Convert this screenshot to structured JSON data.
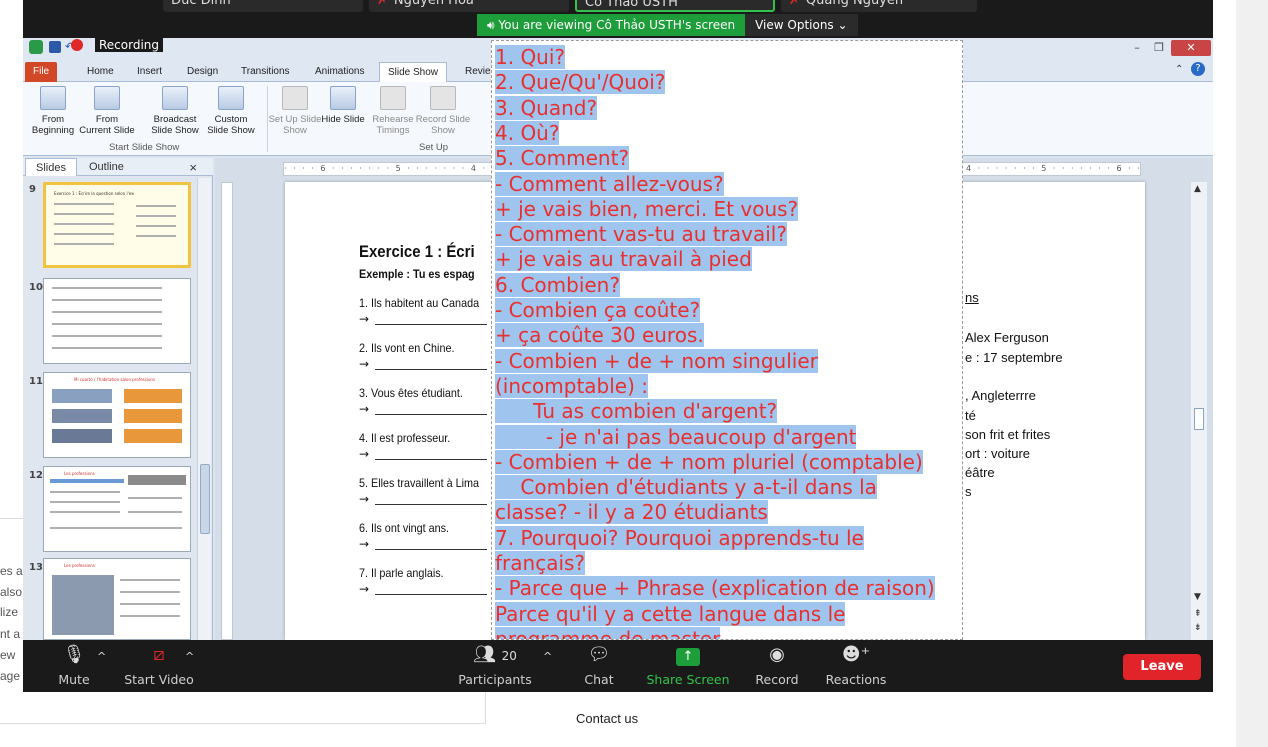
{
  "background": {
    "fragments": [
      "es a",
      "also",
      "lize",
      "nt a",
      "ew",
      "age"
    ],
    "contact_link": "Contact us"
  },
  "zoom": {
    "participants_tiles": [
      "Đức Đình",
      "Nguyễn Hoà",
      "Cô Thảo USTH",
      "Quang Nguyễn"
    ],
    "viewing_text": "You are viewing Cô Thảo USTH's screen",
    "view_options": "View Options",
    "recording_label": "Recording",
    "toolbar": {
      "mute": "Mute",
      "start_video": "Start Video",
      "participants": "Participants",
      "participants_count": "20",
      "chat": "Chat",
      "share_screen": "Share Screen",
      "record": "Record",
      "reactions": "Reactions",
      "leave": "Leave"
    },
    "colors": {
      "share_green": "#1e9e3a",
      "leave_red": "#e0242a"
    }
  },
  "powerpoint": {
    "tabs": [
      "File",
      "Home",
      "Insert",
      "Design",
      "Transitions",
      "Animations",
      "Slide Show",
      "Revie"
    ],
    "ribbon": {
      "from_beginning": "From Beginning",
      "from_current": "From Current Slide",
      "broadcast": "Broadcast Slide Show",
      "custom": "Custom Slide Show",
      "setup": "Set Up Slide Show",
      "hide": "Hide Slide",
      "rehearse": "Rehearse Timings",
      "record": "Record Slide Show",
      "group_start": "Start Slide Show",
      "group_setup": "Set Up"
    },
    "panel_tabs": {
      "slides": "Slides",
      "outline": "Outline"
    },
    "slide_numbers": [
      "9",
      "10",
      "11",
      "12",
      "13"
    ],
    "thumb_titles": [
      "Exercice 1 : Écrire la question selon l'exemple",
      "",
      "Mi cuarto / l'habitation salon professions",
      "Les professions",
      "Les professions"
    ],
    "slide": {
      "title": "Exercice 1 :  Écri",
      "example": "Exemple :   Tu es espag",
      "items": [
        "1. Ils habitent au Canada",
        "2. Ils vont en Chine.",
        "3. Vous êtes étudiant.",
        "4. Il est professeur.",
        "5. Elles travaillent à Lima",
        "6. Ils ont vingt ans.",
        "7. Il parle anglais."
      ],
      "right_texts": [
        "ns",
        "Alex Ferguson",
        "e : 17 septembre",
        ", Angleterrre",
        "té",
        "son frit et frites",
        "ort : voiture",
        "éâtre",
        "s"
      ],
      "ruler_left": "· · · · 6 · · · · · · · 5 · · · · · · · 4 · · · ·",
      "ruler_right": "4 · · · · · · · 5 · · · · · · · 6 · · · · ·"
    }
  },
  "annotation_lines": [
    "1. Qui?",
    "2. Que/Qu'/Quoi?",
    "3. Quand?",
    "4. Où?",
    "5. Comment?",
    "- Comment allez-vous?",
    "+ je vais bien, merci. Et vous?",
    "- Comment vas-tu au travail?",
    "+ je vais au travail à pied",
    "6. Combien?",
    "- Combien ça coûte?",
    "+ ça coûte 30 euros.",
    "- Combien + de + nom singulier",
    "(incomptable) :",
    "      Tu as combien d'argent?",
    "        - je n'ai pas beaucoup d'argent",
    "- Combien + de + nom pluriel (comptable)",
    "    Combien d'étudiants y a-t-il dans la",
    "classe? - il y a 20 étudiants",
    "7. Pourquoi? Pourquoi apprends-tu le",
    "français?",
    "- Parce que + Phrase (explication de raison)",
    "Parce qu'il y a cette langue dans le",
    "programme de master"
  ]
}
